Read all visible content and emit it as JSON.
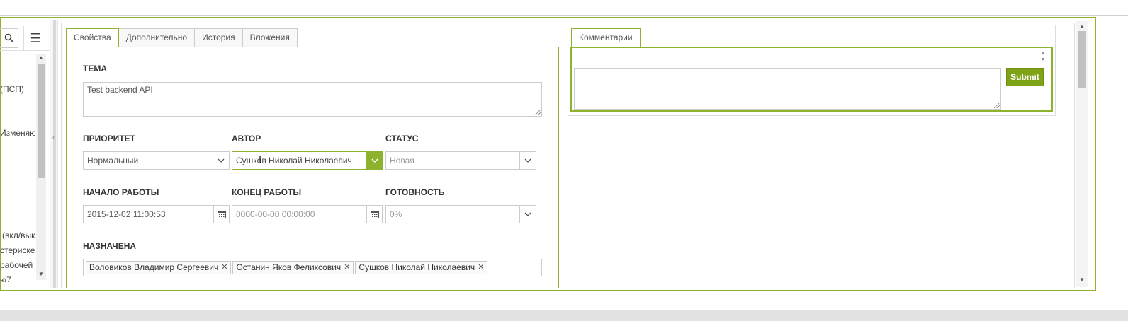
{
  "left_panel": {
    "menu_glyph": "☰",
    "items": [
      "(ПСП)",
      "Изменяю",
      "(вкл/вык",
      "стериске",
      "рабочей",
      "ю7"
    ]
  },
  "tabs": [
    {
      "label": "Свойства",
      "active": true
    },
    {
      "label": "Дополнительно",
      "active": false
    },
    {
      "label": "История",
      "active": false
    },
    {
      "label": "Вложения",
      "active": false
    }
  ],
  "form": {
    "subject_label": "ТЕМА",
    "subject_value": "Test backend API",
    "priority_label": "ПРИОРИТЕТ",
    "priority_value": "Нормальный",
    "author_label": "АВТОР",
    "author_value": "Сушков Николай Николаевич",
    "status_label": "СТАТУС",
    "status_value": "Новая",
    "start_label": "НАЧАЛО РАБОТЫ",
    "start_value": "2015-12-02 11:00:53",
    "end_label": "КОНЕЦ РАБОТЫ",
    "end_placeholder": "0000-00-00 00:00:00",
    "progress_label": "ГОТОВНОСТЬ",
    "progress_value": "0%",
    "assigned_label": "НАЗНАЧЕНА",
    "assigned": [
      "Воловиков Владимир Сергеевич",
      "Останин Яков Феликсович",
      "Сушков Николай Николаевич"
    ]
  },
  "comments": {
    "tab_label": "Комментарии",
    "submit_label": "Submit",
    "text": ""
  },
  "colors": {
    "accent": "#8cb22e",
    "submit": "#7fa317"
  }
}
